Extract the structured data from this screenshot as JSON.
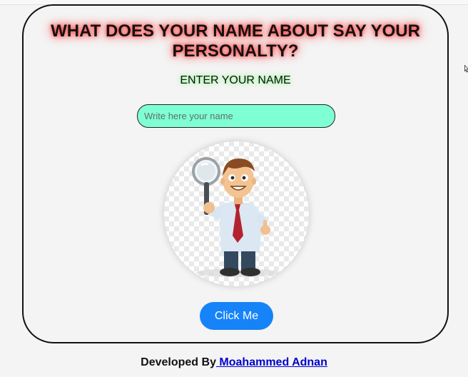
{
  "header": {
    "title_line1": "WHAT DOES YOUR NAME ABOUT SAY YOUR",
    "title_line2": "PERSONALTY?"
  },
  "form": {
    "prompt": "ENTER YOUR NAME",
    "name_placeholder": "Write here your name",
    "name_value": "",
    "submit_label": "Click Me"
  },
  "illustration": {
    "icon": "detective-man-with-magnifier-icon"
  },
  "footer": {
    "developed_by": "Developed By",
    "author": " Moahammed Adnan"
  },
  "colors": {
    "input_background": "#7fffd4",
    "button_background": "#1683f8",
    "title_glow": "#ff3b3b",
    "prompt_glow": "#7cff7c",
    "link": "#0000cc"
  }
}
